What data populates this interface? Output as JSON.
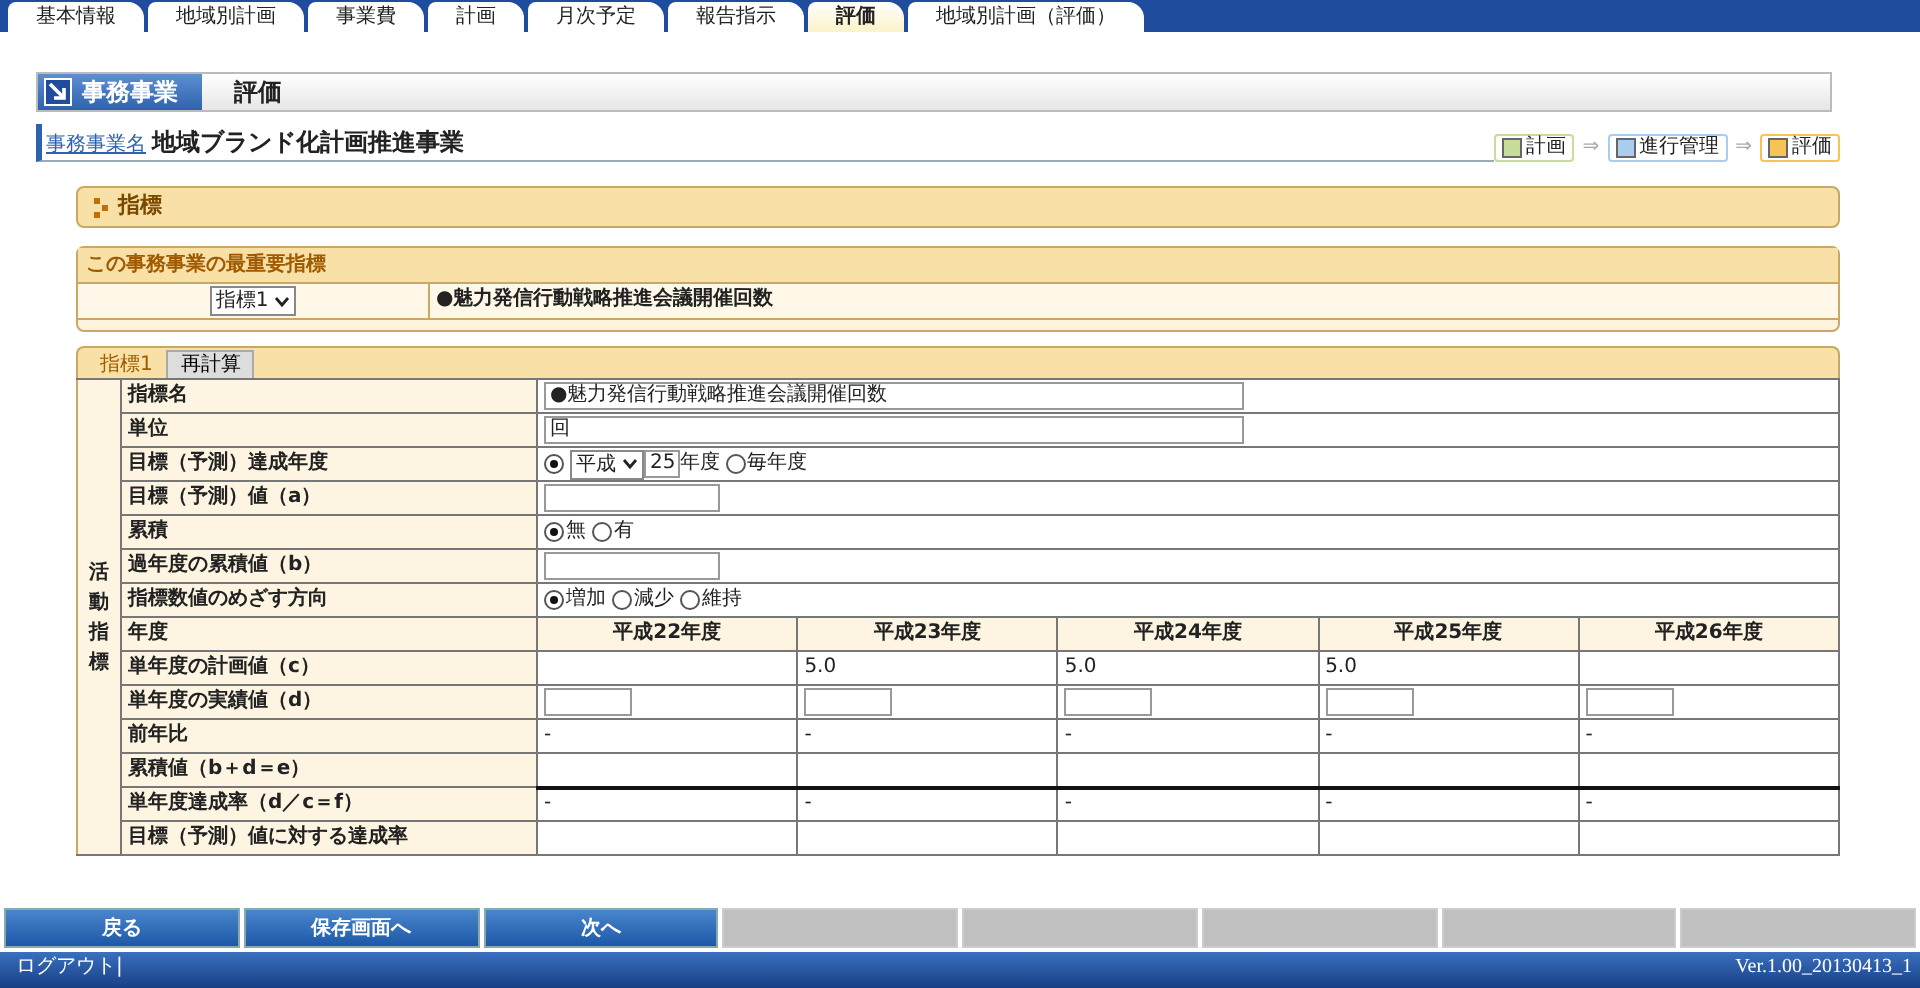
{
  "tabs": [
    {
      "label": "基本情報",
      "selected": false
    },
    {
      "label": "地域別計画",
      "selected": false
    },
    {
      "label": "事業費",
      "selected": false
    },
    {
      "label": "計画",
      "selected": false
    },
    {
      "label": "月次予定",
      "selected": false
    },
    {
      "label": "報告指示",
      "selected": false
    },
    {
      "label": "評価",
      "selected": true
    },
    {
      "label": "地域別計画（評価）",
      "selected": false
    }
  ],
  "header": {
    "category": "事務事業",
    "title": "評価"
  },
  "project": {
    "label": "事務事業名",
    "name": "地域ブランド化計画推進事業"
  },
  "workflow": [
    {
      "label": "計画",
      "color": "#c9dd9a"
    },
    {
      "label": "進行管理",
      "color": "#a9cdef"
    },
    {
      "label": "評価",
      "color": "#f6c357"
    }
  ],
  "workflow_arrows": [
    "⇒",
    "⇒"
  ],
  "section_title": "指標",
  "key_indicator": {
    "title": "この事務事業の最重要指標",
    "select": "指標1",
    "text": "●魅力発信行動戦略推進会議開催回数"
  },
  "indicator_tabs": [
    {
      "label": "指標1",
      "selected": true
    },
    {
      "label": "再計算",
      "selected": false
    }
  ],
  "side_label": "活動指標",
  "fields": [
    {
      "kind": "text",
      "label": "指標名",
      "value": "●魅力発信行動戦略推進会議開催回数"
    },
    {
      "kind": "text",
      "label": "単位",
      "value": "回"
    },
    {
      "kind": "year",
      "label": "目標（予測）達成年度",
      "era": "平成",
      "year": "25",
      "suffix": "年度",
      "options": [
        {
          "selected": true
        },
        {
          "label": "毎年度",
          "selected": false
        }
      ]
    },
    {
      "kind": "short",
      "label": "目標（予測）値（a）"
    },
    {
      "kind": "radio",
      "label": "累積",
      "options": [
        {
          "label": "無",
          "selected": true
        },
        {
          "label": "有",
          "selected": false
        }
      ]
    },
    {
      "kind": "short",
      "label": "過年度の累積値（b）"
    },
    {
      "kind": "radio",
      "label": "指標数値のめざす方向",
      "options": [
        {
          "label": "増加",
          "selected": true
        },
        {
          "label": "減少",
          "selected": false
        },
        {
          "label": "維持",
          "selected": false
        }
      ]
    }
  ],
  "years": {
    "label": "年度",
    "columns": [
      "平成22年度",
      "平成23年度",
      "平成24年度",
      "平成25年度",
      "平成26年度"
    ]
  },
  "year_rows": [
    {
      "kind": "text",
      "label": "単年度の計画値（c）",
      "cells": [
        null,
        "5.0",
        "5.0",
        "5.0",
        null
      ]
    },
    {
      "kind": "input",
      "label": "単年度の実績値（d）"
    },
    {
      "kind": "text",
      "label": "前年比",
      "cells": [
        "-",
        "-",
        "-",
        "-",
        "-"
      ]
    },
    {
      "kind": "text",
      "label": "累積値（b＋d＝e）",
      "cells": [
        null,
        null,
        null,
        null,
        null
      ]
    },
    {
      "kind": "text",
      "label": "単年度達成率（d／c＝f）",
      "cells": [
        "-",
        "-",
        "-",
        "-",
        "-"
      ]
    },
    {
      "kind": "text",
      "label": "目標（予測）値に対する達成率",
      "cells": [
        null,
        null,
        null,
        null,
        null
      ]
    }
  ],
  "buttons": [
    {
      "label": "戻る",
      "disabled": false
    },
    {
      "label": "保存画面へ",
      "disabled": false
    },
    {
      "label": "次へ",
      "disabled": false
    },
    {
      "disabled": true
    },
    {
      "disabled": true
    },
    {
      "disabled": true
    },
    {
      "disabled": true
    },
    {
      "disabled": true
    }
  ],
  "footer": {
    "logout": "ログアウト|",
    "version": "Ver.1.00_20130413_1"
  }
}
